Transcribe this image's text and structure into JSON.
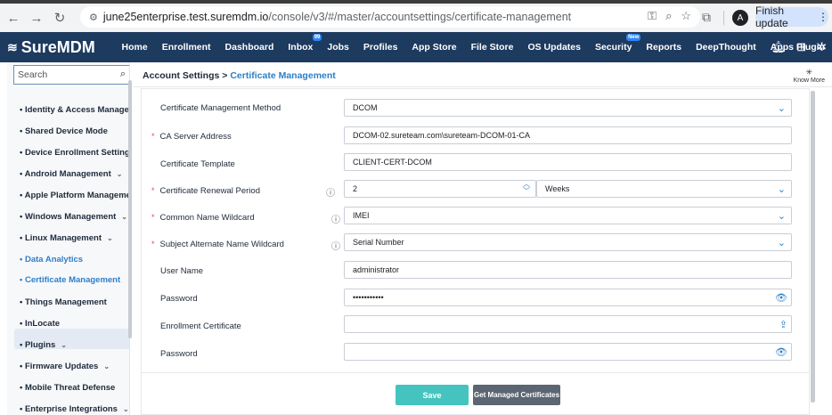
{
  "browser": {
    "url_host": "june25enterprise.test.suremdm.io",
    "url_path": "/console/v3/#/master/accountsettings/certificate-management",
    "profile_letter": "A",
    "finish_update": "Finish update"
  },
  "app": {
    "logo": "SureMDM",
    "menu": [
      "Home",
      "Enrollment",
      "Dashboard",
      "Inbox",
      "Jobs",
      "Profiles",
      "App Store",
      "File Store",
      "OS Updates",
      "Security",
      "Reports",
      "DeepThought",
      "Apps Plugin"
    ],
    "inbox_badge": "99",
    "security_badge": "New"
  },
  "sidebar": {
    "search_placeholder": "Search",
    "items": [
      {
        "label": "Identity & Access Management",
        "chev": ""
      },
      {
        "label": "Shared Device Mode",
        "chev": ""
      },
      {
        "label": "Device Enrollment Settings",
        "chev": "⌄"
      },
      {
        "label": "Android Management",
        "chev": "⌄"
      },
      {
        "label": "Apple Platform Management",
        "chev": "⌄"
      },
      {
        "label": "Windows Management",
        "chev": "⌄"
      },
      {
        "label": "Linux Management",
        "chev": "⌄"
      },
      {
        "label": "Data Analytics",
        "chev": ""
      },
      {
        "label": "Certificate Management",
        "chev": ""
      },
      {
        "label": "Things Management",
        "chev": ""
      },
      {
        "label": "InLocate",
        "chev": ""
      },
      {
        "label": "Plugins",
        "chev": "⌄"
      },
      {
        "label": "Firmware Updates",
        "chev": "⌄"
      },
      {
        "label": "Mobile Threat Defense",
        "chev": ""
      },
      {
        "label": "Enterprise Integrations",
        "chev": "⌄"
      }
    ]
  },
  "breadcrumb": {
    "root": "Account Settings",
    "sep": ">",
    "current": "Certificate Management"
  },
  "know_more": "Know More",
  "form": {
    "method_label": "Certificate Management Method",
    "method_value": "DCOM",
    "ca_label": "CA Server Address",
    "ca_value": "DCOM-02.sureteam.com\\sureteam-DCOM-01-CA",
    "template_label": "Certificate Template",
    "template_value": "CLIENT-CERT-DCOM",
    "renewal_label": "Certificate Renewal Period",
    "renewal_value": "2",
    "renewal_unit": "Weeks",
    "cn_label": "Common Name Wildcard",
    "cn_value": "IMEI",
    "san_label": "Subject Alternate Name Wildcard",
    "san_value": "Serial Number",
    "user_label": "User Name",
    "user_value": "administrator",
    "pass_label": "Password",
    "pass_value": "•••••••••••",
    "enroll_label": "Enrollment Certificate",
    "enroll_value": "",
    "pass2_label": "Password",
    "pass2_value": ""
  },
  "buttons": {
    "save": "Save",
    "get_certs": "Get Managed Certificates"
  }
}
